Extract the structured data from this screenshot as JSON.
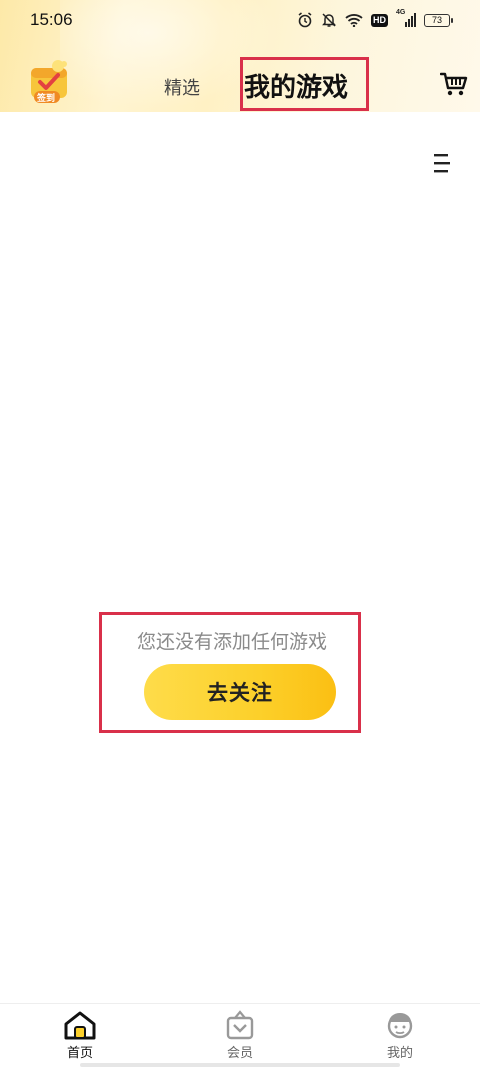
{
  "status_bar": {
    "time": "15:06",
    "hd_label": "HD",
    "network_label": "4G",
    "battery_level": "73"
  },
  "top_nav": {
    "signin_badge": "签到",
    "tabs": [
      {
        "label": "精选",
        "active": false
      },
      {
        "label": "我的游戏",
        "active": true
      }
    ]
  },
  "empty_state": {
    "message": "您还没有添加任何游戏",
    "button_label": "去关注"
  },
  "bottom_nav": {
    "items": [
      {
        "label": "首页",
        "icon": "home-icon",
        "active": true
      },
      {
        "label": "会员",
        "icon": "member-icon",
        "active": false
      },
      {
        "label": "我的",
        "icon": "profile-icon",
        "active": false
      }
    ]
  },
  "colors": {
    "accent_yellow": "#fcd02a",
    "highlight_red": "#d9304a",
    "header_gradient": "#fde9a8"
  }
}
